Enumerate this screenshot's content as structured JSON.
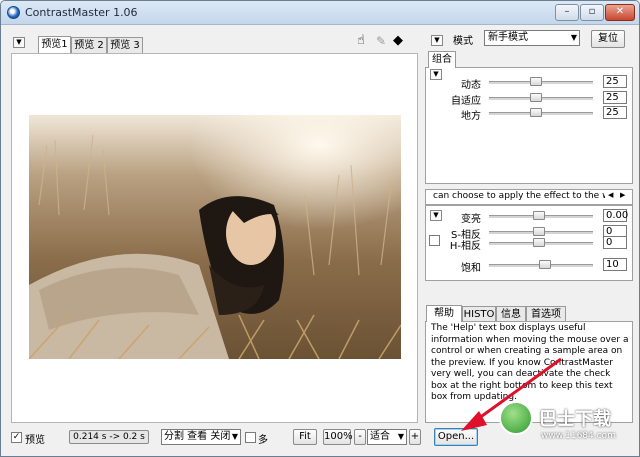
{
  "window": {
    "title": "ContrastMaster 1.06",
    "min": "–",
    "max": "▫",
    "close": "✕"
  },
  "preview_tabs": [
    "预览1",
    "预览 2",
    "预览 3"
  ],
  "tools": {
    "hand": "☝",
    "picker": "✎",
    "split": "◆"
  },
  "mode": {
    "label": "模式",
    "value": "新手模式",
    "reset": "复位"
  },
  "group1": {
    "tab": "组合",
    "rows": [
      {
        "label": "动态",
        "value": "25",
        "pos": 0.45
      },
      {
        "label": "自适应",
        "value": "25",
        "pos": 0.45
      },
      {
        "label": "地方",
        "value": "25",
        "pos": 0.45
      }
    ]
  },
  "group2": {
    "text": "can choose to apply the effect to the whole in",
    "rows": [
      {
        "label": "变亮",
        "value": "0.00",
        "pos": 0.48
      },
      {
        "label": "S-相反",
        "value": "0",
        "pos": 0.48
      },
      {
        "label": "H-相反",
        "value": "0",
        "pos": 0.48
      },
      {
        "label": "饱和",
        "value": "10",
        "pos": 0.54
      }
    ]
  },
  "help": {
    "tabs": [
      "帮助",
      "HISTO",
      "信息",
      "首选项"
    ],
    "text": "The 'Help' text box displays useful information when moving the mouse over a control or when creating a sample area on the preview. If you know ContrastMaster very well, you can deactivate the check box at the right bottom to keep this text box from updating."
  },
  "bottom": {
    "preview_check": "✓",
    "preview_label": "预览",
    "timing": "0.214 s -> 0.2 s",
    "split_view": "分割 查看 关闭",
    "multi_label": "多",
    "fit": "Fit",
    "zoom": "100%",
    "minus": "-",
    "fit_select": "适合",
    "plus": "+",
    "open": "Open..."
  },
  "watermark": {
    "site": "巴士下载",
    "url": "www.11684.com"
  },
  "colors": {
    "accent": "#2a6bc2",
    "arrow": "#e0102a"
  }
}
